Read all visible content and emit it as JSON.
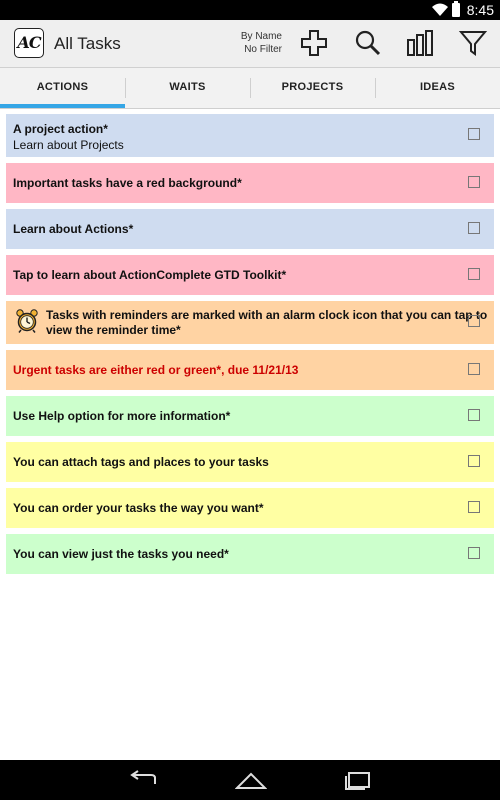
{
  "status_bar": {
    "time": "8:45"
  },
  "action_bar": {
    "logo": "AC",
    "title": "All Tasks",
    "sort_line1": "By Name",
    "sort_line2": "No Filter"
  },
  "tabs": [
    {
      "label": "ACTIONS",
      "selected": true
    },
    {
      "label": "WAITS",
      "selected": false
    },
    {
      "label": "PROJECTS",
      "selected": false
    },
    {
      "label": "IDEAS",
      "selected": false
    }
  ],
  "colors": {
    "blue": "#cfdcf0",
    "red": "#ffb7c5",
    "orange": "#ffd3a3",
    "green": "#ccffcc",
    "yellow": "#ffffa3",
    "urgent_text": "#cc0000",
    "tab_indicator": "#35a6e6"
  },
  "tasks": [
    {
      "title": "A project action*",
      "subtitle": "Learn about Projects",
      "color": "blue"
    },
    {
      "title": "Important tasks have a red background*",
      "color": "red"
    },
    {
      "title": "Learn about Actions*",
      "color": "blue"
    },
    {
      "title": "Tap to learn about ActionComplete GTD Toolkit*",
      "color": "red"
    },
    {
      "title_line1": "Tasks with reminders are marked with an alarm clock icon that you can tap to",
      "title_line2": "view the reminder time*",
      "color": "orange",
      "icon": "alarm-clock-icon"
    },
    {
      "title": "Urgent tasks are either red or green*, due 11/21/13",
      "color": "orange",
      "urgent": true
    },
    {
      "title": "Use Help option for more information*",
      "color": "green"
    },
    {
      "title": "You can attach tags and places to your tasks",
      "color": "yellow"
    },
    {
      "title": "You can order your tasks the way you want*",
      "color": "yellow"
    },
    {
      "title": "You can view just the tasks you need*",
      "color": "green"
    }
  ],
  "nav_bar": {
    "icons": [
      "back-icon",
      "home-icon",
      "recents-icon"
    ]
  }
}
